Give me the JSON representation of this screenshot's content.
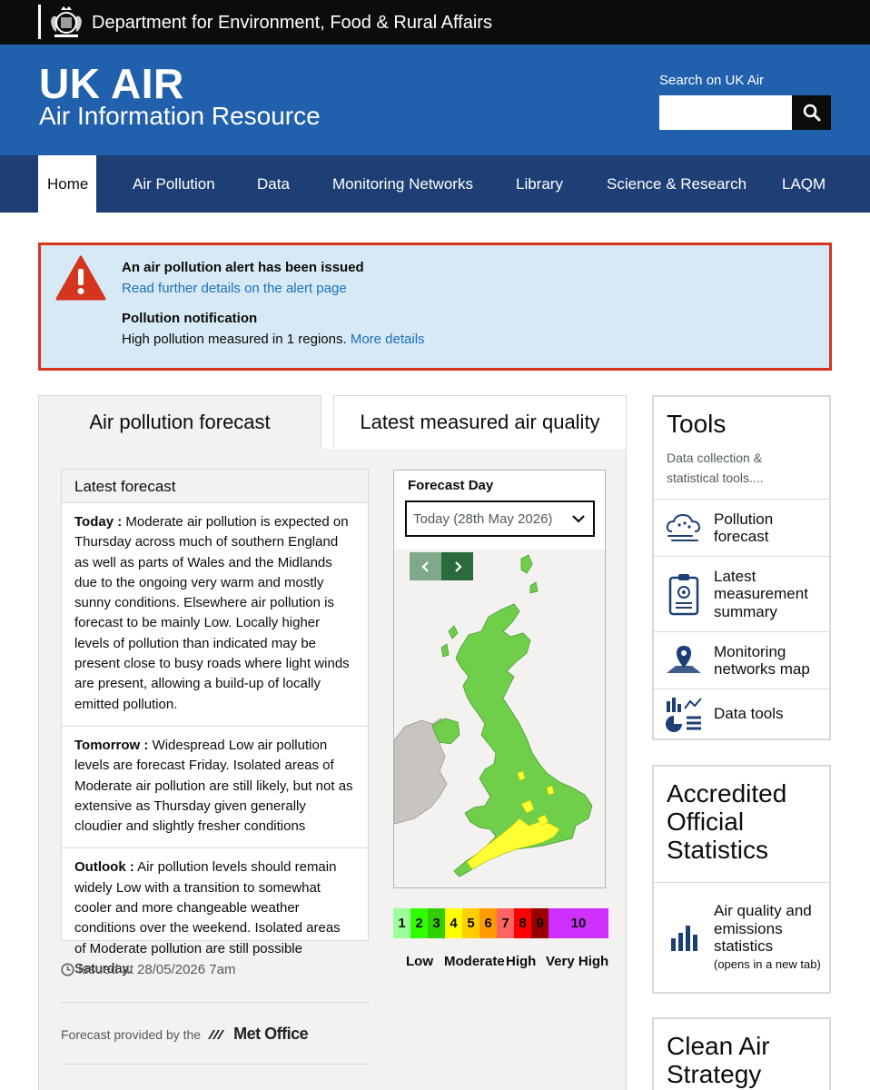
{
  "gov_header": {
    "department": "Department for Environment, Food & Rural Affairs"
  },
  "brand": {
    "title": "UK AIR",
    "subtitle": "Air Information Resource",
    "search_label": "Search on UK Air",
    "search_value": ""
  },
  "nav": [
    "Home",
    "Air Pollution",
    "Data",
    "Monitoring Networks",
    "Library",
    "Science & Research",
    "LAQM"
  ],
  "alert": {
    "title": "An air pollution alert has been issued",
    "link": "Read further details on the alert page",
    "notification_title": "Pollution notification",
    "notification_text": "High pollution measured in 1 regions.",
    "notification_link": "More details"
  },
  "tabs": [
    "Air pollution forecast",
    "Latest measured air quality"
  ],
  "forecast": {
    "heading": "Latest forecast",
    "today_label": "Today :",
    "today_text": "Moderate air pollution is expected on Thursday across much of southern England as well as parts of Wales and the Midlands due to the ongoing very warm and mostly sunny conditions. Elsewhere air pollution is forecast to be mainly Low. Locally higher levels of pollution than indicated may be present close to busy roads where light winds are present, allowing a build-up of locally emitted pollution.",
    "tomorrow_label": "Tomorrow :",
    "tomorrow_text": "Widespread Low air pollution levels are forecast Friday. Isolated areas of Moderate air pollution are still likely, but not as extensive as Thursday given generally cloudier and slightly fresher conditions",
    "outlook_label": "Outlook :",
    "outlook_text": "Air pollution levels should remain widely Low with a transition to somewhat cooler and more changeable weather conditions over the weekend. Isolated areas of Moderate pollution are still possible Saturday.",
    "issued": "Issued at 28/05/2026 7am",
    "provided_by": "Forecast provided by the",
    "provider": "Met Office"
  },
  "map": {
    "forecast_day_label": "Forecast Day",
    "selected_day": "Today (28th May 2026)",
    "scale": [
      {
        "label": "1",
        "color": "#9cff9c"
      },
      {
        "label": "2",
        "color": "#31ff00"
      },
      {
        "label": "3",
        "color": "#31cf00"
      },
      {
        "label": "4",
        "color": "#ffff00"
      },
      {
        "label": "5",
        "color": "#ffcf00"
      },
      {
        "label": "6",
        "color": "#ff9a00"
      },
      {
        "label": "7",
        "color": "#ff6464"
      },
      {
        "label": "8",
        "color": "#ff0000"
      },
      {
        "label": "9",
        "color": "#990000"
      },
      {
        "label": "10",
        "color": "#ce30ff"
      }
    ],
    "bands": [
      "Low",
      "Moderate",
      "High",
      "Very High"
    ]
  },
  "tools": {
    "title": "Tools",
    "description": "Data collection & statistical tools....",
    "items": [
      {
        "label": "Pollution forecast",
        "icon": "cloud-forecast-icon"
      },
      {
        "label": "Latest measurement summary",
        "icon": "clipboard-icon"
      },
      {
        "label": "Monitoring networks map",
        "icon": "map-pin-icon"
      },
      {
        "label": "Data tools",
        "icon": "charts-icon"
      }
    ]
  },
  "accredited": {
    "title": "Accredited Official Statistics",
    "item_label": "Air quality and emissions statistics",
    "item_note": "(opens in a new tab)"
  },
  "clean_air": {
    "title": "Clean Air Strategy"
  }
}
